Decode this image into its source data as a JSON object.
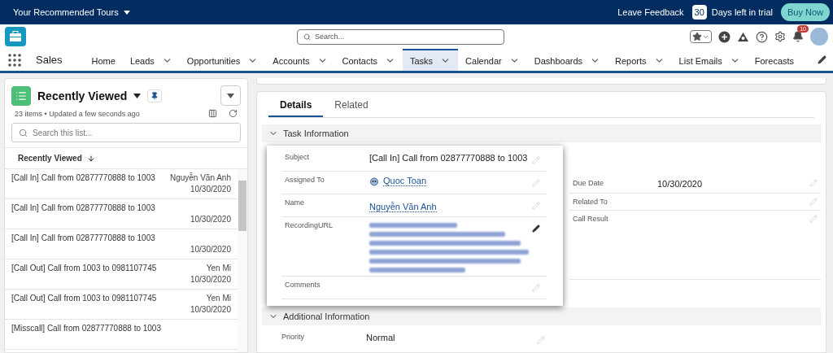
{
  "top_bar": {
    "tours_label": "Your Recommended Tours",
    "leave_feedback": "Leave Feedback",
    "trial_days": "30",
    "trial_text": "Days left in trial",
    "buy_now": "Buy Now"
  },
  "header": {
    "search_placeholder": "Search...",
    "notification_count": "10"
  },
  "nav": {
    "app_name": "Sales",
    "items": [
      {
        "label": "Home",
        "selected": false,
        "has_menu": false
      },
      {
        "label": "Leads",
        "selected": false,
        "has_menu": true
      },
      {
        "label": "Opportunities",
        "selected": false,
        "has_menu": true
      },
      {
        "label": "Accounts",
        "selected": false,
        "has_menu": true
      },
      {
        "label": "Contacts",
        "selected": false,
        "has_menu": true
      },
      {
        "label": "Tasks",
        "selected": true,
        "has_menu": true
      },
      {
        "label": "Calendar",
        "selected": false,
        "has_menu": true
      },
      {
        "label": "Dashboards",
        "selected": false,
        "has_menu": true
      },
      {
        "label": "Reports",
        "selected": false,
        "has_menu": true
      },
      {
        "label": "List Emails",
        "selected": false,
        "has_menu": true
      },
      {
        "label": "Forecasts",
        "selected": false,
        "has_menu": false
      }
    ]
  },
  "list_view": {
    "title": "Recently Viewed",
    "summary": "23 items • Updated a few seconds ago",
    "search_placeholder": "Search this list...",
    "sort_column": "Recently Viewed",
    "rows": [
      {
        "subject": "[Call In] Call from 02877770888 to 1003",
        "owner": "Nguyễn Văn Anh",
        "date": "10/30/2020"
      },
      {
        "subject": "[Call In] Call from 02877770888 to 1003",
        "date": "10/30/2020"
      },
      {
        "subject": "[Call In] Call from 02877770888 to 1003",
        "date": "10/30/2020"
      },
      {
        "subject": "[Call Out] Call from 1003 to 0981107745",
        "owner": "Yen Mi",
        "date": "10/30/2020"
      },
      {
        "subject": "[Call Out] Call from 1003 to 0981107745",
        "owner": "Yen Mi",
        "date": "10/30/2020"
      },
      {
        "subject": "[Misscall] Call from 02877770888 to 1003"
      }
    ]
  },
  "detail": {
    "tabs": [
      {
        "label": "Details",
        "selected": true
      },
      {
        "label": "Related",
        "selected": false
      }
    ],
    "task_information": {
      "title": "Task Information",
      "expanded": true,
      "left_fields": [
        {
          "label": "Subject",
          "kind": "text",
          "value": "[Call In] Call from 02877770888 to 1003",
          "hovered": false
        },
        {
          "label": "Assigned To",
          "kind": "user_link",
          "value": "Quoc Toan",
          "hovered": false
        },
        {
          "label": "Name",
          "kind": "link",
          "value": "Nguyễn Văn Anh",
          "hovered": false
        },
        {
          "label": "RecordingURL",
          "kind": "blurred_link",
          "hovered": true
        },
        {
          "label": "Comments",
          "kind": "empty",
          "hovered": false
        }
      ],
      "right_fields": [
        {
          "label": "Due Date",
          "kind": "text",
          "value": "10/30/2020"
        },
        {
          "label": "Related To",
          "kind": "empty"
        },
        {
          "label": "Call Result",
          "kind": "empty"
        }
      ]
    },
    "additional_information": {
      "title": "Additional Information",
      "expanded": true,
      "fields": [
        {
          "label": "Priority",
          "kind": "text",
          "value": "Normal",
          "hovered": false
        }
      ]
    }
  }
}
